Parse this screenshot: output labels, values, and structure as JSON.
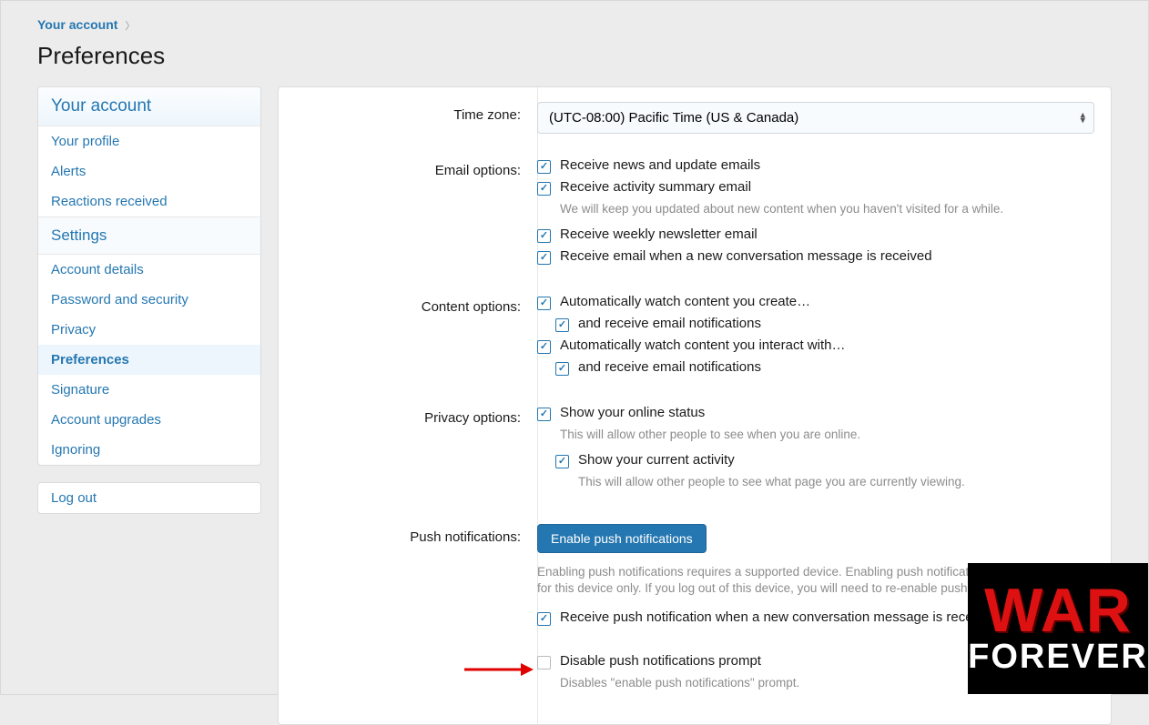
{
  "breadcrumb": {
    "link": "Your account"
  },
  "page_title": "Preferences",
  "sidebar": {
    "heading1": "Your account",
    "items1": [
      "Your profile",
      "Alerts",
      "Reactions received"
    ],
    "heading2": "Settings",
    "items2": [
      "Account details",
      "Password and security",
      "Privacy",
      "Preferences",
      "Signature",
      "Account upgrades",
      "Ignoring"
    ],
    "active": "Preferences",
    "logout": "Log out"
  },
  "form": {
    "timezone": {
      "label": "Time zone:",
      "value": "(UTC-08:00) Pacific Time (US & Canada)"
    },
    "email": {
      "label": "Email options:",
      "opt1": "Receive news and update emails",
      "opt2": "Receive activity summary email",
      "opt2hint": "We will keep you updated about new content when you haven't visited for a while.",
      "opt3": "Receive weekly newsletter email",
      "opt4": "Receive email when a new conversation message is received"
    },
    "content": {
      "label": "Content options:",
      "opt1": "Automatically watch content you create…",
      "sub1": "and receive email notifications",
      "opt2": "Automatically watch content you interact with…",
      "sub2": "and receive email notifications"
    },
    "privacy": {
      "label": "Privacy options:",
      "opt1": "Show your online status",
      "hint1": "This will allow other people to see when you are online.",
      "opt2": "Show your current activity",
      "hint2": "This will allow other people to see what page you are currently viewing."
    },
    "push": {
      "label": "Push notifications:",
      "button": "Enable push notifications",
      "hint": "Enabling push notifications requires a supported device. Enabling push notifications will enable them for this device only. If you log out of this device, you will need to re-enable push notifications.",
      "opt1": "Receive push notification when a new conversation message is received",
      "opt2": "Disable push notifications prompt",
      "hint2": "Disables \"enable push notifications\" prompt."
    }
  },
  "logo": {
    "line1": "WAR",
    "line2": "FOREVER"
  }
}
